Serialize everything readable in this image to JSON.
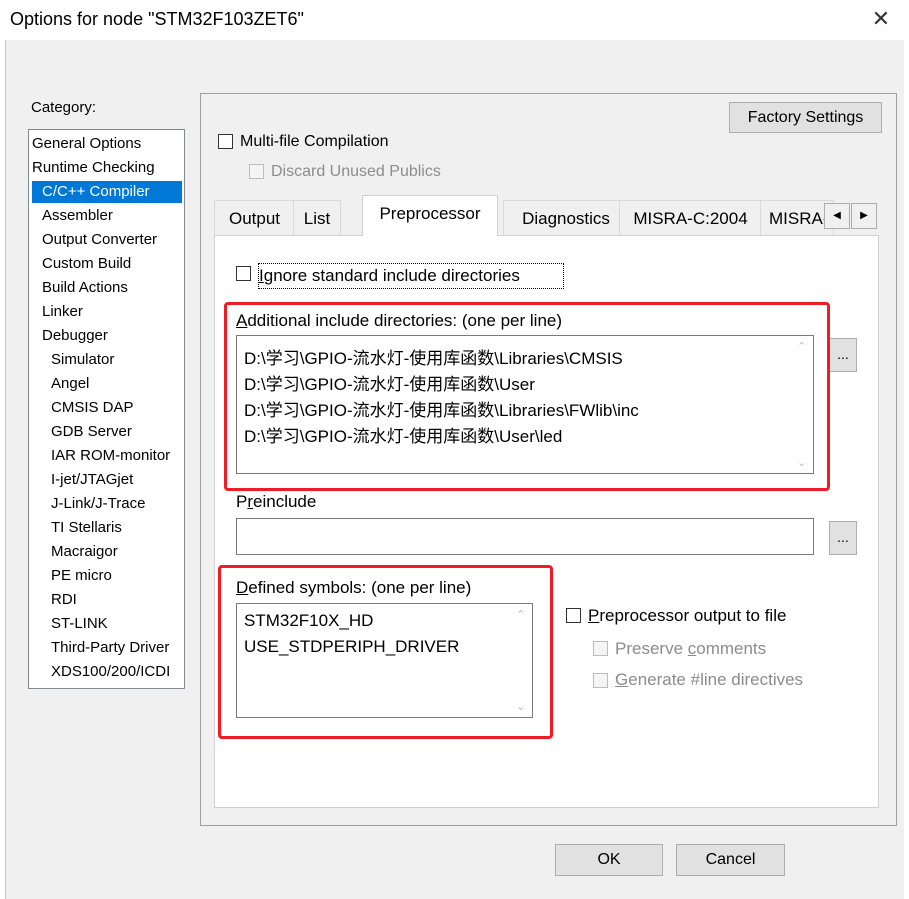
{
  "window": {
    "title": "Options for node \"STM32F103ZET6\"",
    "close_glyph": "✕"
  },
  "category": {
    "label": "Category:",
    "items": [
      "General Options",
      "Runtime Checking",
      "C/C++ Compiler",
      "Assembler",
      "Output Converter",
      "Custom Build",
      "Build Actions",
      "Linker",
      "Debugger",
      "Simulator",
      "Angel",
      "CMSIS DAP",
      "GDB Server",
      "IAR ROM-monitor",
      "I-jet/JTAGjet",
      "J-Link/J-Trace",
      "TI Stellaris",
      "Macraigor",
      "PE micro",
      "RDI",
      "ST-LINK",
      "Third-Party Driver",
      "XDS100/200/ICDI"
    ],
    "selected": "C/C++ Compiler"
  },
  "options": {
    "factory_settings": "Factory Settings",
    "multi_file": {
      "label": "Multi-file Compilation",
      "checked": false
    },
    "discard_unused": {
      "label": "Discard Unused Publics",
      "checked": false,
      "disabled": true
    }
  },
  "tabs": {
    "items": [
      "Output",
      "List",
      "Preprocessor",
      "Diagnostics",
      "MISRA-C:2004",
      "MISRA-"
    ],
    "active": "Preprocessor",
    "scroll_left": "◀",
    "scroll_right": "▶"
  },
  "preprocessor": {
    "ignore_std_prefix": "I",
    "ignore_std_rest": "gnore standard include directories",
    "include_dirs": {
      "label_prefix": "A",
      "label_rest": "dditional include directories: (one per line)",
      "lines": [
        "D:\\学习\\GPIO-流水灯-使用库函数\\Libraries\\CMSIS",
        "D:\\学习\\GPIO-流水灯-使用库函数\\User",
        "D:\\学习\\GPIO-流水灯-使用库函数\\Libraries\\FWlib\\inc",
        "D:\\学习\\GPIO-流水灯-使用库函数\\User\\led"
      ],
      "browse": "..."
    },
    "preinclude": {
      "label_prefix": "P",
      "label_mid": "r",
      "label_rest": "einclude",
      "value": "",
      "browse": "..."
    },
    "defined_symbols": {
      "label_prefix": "D",
      "label_rest": "efined symbols: (one per line)",
      "lines": [
        "STM32F10X_HD",
        "USE_STDPERIPH_DRIVER"
      ]
    },
    "pp_output": {
      "label_prefix": "P",
      "label_rest": "reprocessor output to file",
      "checked": false
    },
    "preserve_comments": {
      "label_pre": "Preserve ",
      "label_u": "c",
      "label_rest": "omments",
      "checked": false
    },
    "generate_line": {
      "label_u": "G",
      "label_rest": "enerate #line directives",
      "checked": false
    }
  },
  "dialog_buttons": {
    "ok": "OK",
    "cancel": "Cancel"
  },
  "scroll_arrows": {
    "up": "⌃",
    "down": "⌄"
  },
  "colors": {
    "highlight": "#ee1c24",
    "selection": "#0078d7"
  }
}
